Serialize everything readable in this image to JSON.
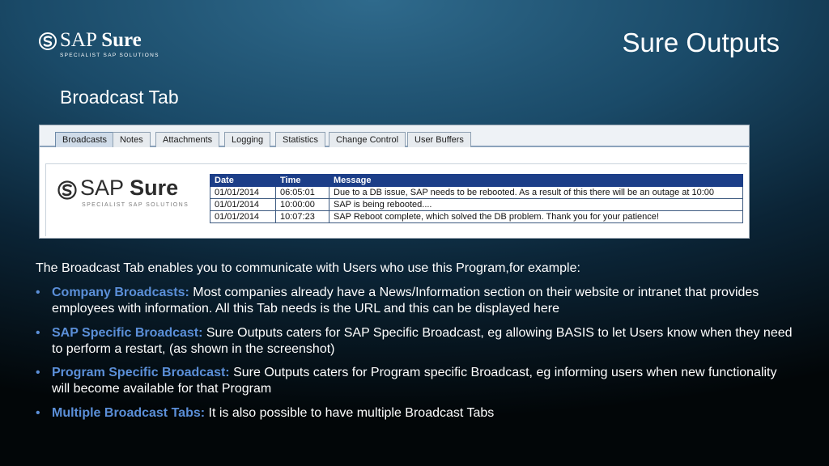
{
  "logo": {
    "name_light": "SAP",
    "name_bold": "Sure",
    "tagline": "SPECIALIST SAP SOLUTIONS"
  },
  "slide_title": "Sure Outputs",
  "subtitle": "Broadcast Tab",
  "screenshot": {
    "tabs": [
      {
        "label": "Broadcasts",
        "active": true
      },
      {
        "label": "Notes",
        "active": false
      },
      {
        "label": "Attachments",
        "active": false
      },
      {
        "label": "Logging",
        "active": false
      },
      {
        "label": "Statistics",
        "active": false
      },
      {
        "label": "Change Control",
        "active": false
      },
      {
        "label": "User Buffers",
        "active": false
      }
    ],
    "logo": {
      "name_light": "SAP",
      "name_bold": "Sure",
      "tagline": "SPECIALIST SAP SOLUTIONS"
    },
    "table": {
      "headers": [
        "Date",
        "Time",
        "Message"
      ],
      "rows": [
        [
          "01/01/2014",
          "06:05:01",
          "Due to a DB issue, SAP needs to be rebooted. As a result of this there will be an outage at 10:00"
        ],
        [
          "01/01/2014",
          "10:00:00",
          "SAP is being rebooted...."
        ],
        [
          "01/01/2014",
          "10:07:23",
          "SAP Reboot complete, which solved the DB problem. Thank you for your patience!"
        ]
      ]
    }
  },
  "intro": "The Broadcast Tab enables you to communicate with Users who use this Program,for example:",
  "bullets": [
    {
      "lead": "Company Broadcasts:",
      "text": " Most companies already have a News/Information section on their website or intranet that provides employees with information. All this Tab needs is the URL and this can be displayed here"
    },
    {
      "lead": "SAP Specific Broadcast:",
      "text": " Sure Outputs caters for SAP Specific Broadcast, eg allowing BASIS to let Users know when they need to perform a restart, (as shown in the screenshot)"
    },
    {
      "lead": "Program Specific Broadcast:",
      "text": " Sure Outputs caters for Program specific Broadcast, eg informing users when new functionality will become available for that Program"
    },
    {
      "lead": "Multiple Broadcast Tabs:",
      "text": " It is also possible to have multiple Broadcast Tabs"
    }
  ],
  "bullet_glyph": "•",
  "colors": {
    "accent": "#5b8fd8",
    "table_header": "#1c3e88"
  }
}
